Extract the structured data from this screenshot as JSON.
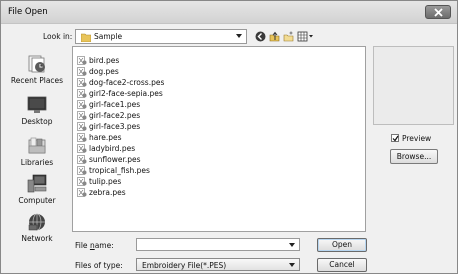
{
  "window": {
    "title": "File Open"
  },
  "lookin": {
    "label": "Look in:",
    "value": "Sample"
  },
  "toolbar": {
    "icons": [
      "back-icon",
      "up-folder-icon",
      "new-folder-icon",
      "view-menu-icon"
    ]
  },
  "places": [
    {
      "label": "Recent Places",
      "icon": "recent-places-icon"
    },
    {
      "label": "Desktop",
      "icon": "desktop-icon"
    },
    {
      "label": "Libraries",
      "icon": "libraries-icon"
    },
    {
      "label": "Computer",
      "icon": "computer-icon"
    },
    {
      "label": "Network",
      "icon": "network-icon"
    }
  ],
  "files": [
    "bird.pes",
    "dog.pes",
    "dog-face2-cross.pes",
    "girl2-face-sepia.pes",
    "girl-face1.pes",
    "girl-face2.pes",
    "girl-face3.pes",
    "hare.pes",
    "ladybird.pes",
    "sunflower.pes",
    "tropical_fish.pes",
    "tulip.pes",
    "zebra.pes"
  ],
  "preview": {
    "label": "Preview",
    "checked": true,
    "browse_label": "Browse..."
  },
  "filename": {
    "label_pre": "File ",
    "label_ul": "n",
    "label_post": "ame:",
    "value": ""
  },
  "filetype": {
    "label": "Files of type:",
    "value": "Embroidery File(*.PES)"
  },
  "buttons": {
    "open": "Open",
    "cancel": "Cancel"
  },
  "colors": {
    "accent": "#b8d6f0",
    "folder": "#e8c45a"
  }
}
